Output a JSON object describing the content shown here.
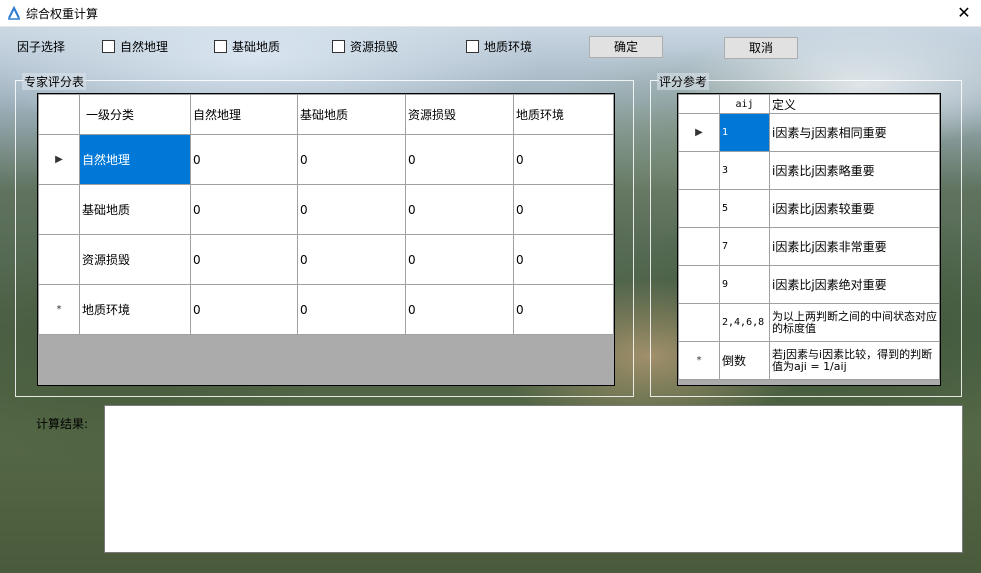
{
  "window": {
    "title": "综合权重计算",
    "close": "✕"
  },
  "factor_select": {
    "label": "因子选择",
    "options": [
      {
        "label": "自然地理",
        "checked": false
      },
      {
        "label": "基础地质",
        "checked": false
      },
      {
        "label": "资源损毁",
        "checked": false
      },
      {
        "label": "地质环境",
        "checked": false
      }
    ]
  },
  "buttons": {
    "ok": "确定",
    "cancel": "取消"
  },
  "expert_panel": {
    "legend": "专家评分表",
    "columns": [
      "一级分类",
      "自然地理",
      "基础地质",
      "资源损毁",
      "地质环境"
    ],
    "rows": [
      {
        "marker": "▶",
        "name": "自然地理",
        "values": [
          "0",
          "0",
          "0",
          "0"
        ]
      },
      {
        "marker": "",
        "name": "基础地质",
        "values": [
          "0",
          "0",
          "0",
          "0"
        ]
      },
      {
        "marker": "",
        "name": "资源损毁",
        "values": [
          "0",
          "0",
          "0",
          "0"
        ]
      },
      {
        "marker": "*",
        "name": "地质环境",
        "values": [
          "0",
          "0",
          "0",
          "0"
        ]
      }
    ]
  },
  "reference_panel": {
    "legend": "评分参考",
    "columns": [
      "aij",
      "定义"
    ],
    "rows": [
      {
        "marker": "▶",
        "aij": "1",
        "def": "i因素与j因素相同重要"
      },
      {
        "marker": "",
        "aij": "3",
        "def": "i因素比j因素略重要"
      },
      {
        "marker": "",
        "aij": "5",
        "def": "i因素比j因素较重要"
      },
      {
        "marker": "",
        "aij": "7",
        "def": "i因素比j因素非常重要"
      },
      {
        "marker": "",
        "aij": "9",
        "def": "i因素比j因素绝对重要"
      },
      {
        "marker": "",
        "aij": "2,4,6,8",
        "def": "为以上两判断之间的中间状态对应的标度值"
      },
      {
        "marker": "*",
        "aij": "倒数",
        "def": "若j因素与i因素比较，得到的判断值为aji = 1/aij"
      }
    ]
  },
  "result": {
    "label": "计算结果:",
    "value": ""
  }
}
